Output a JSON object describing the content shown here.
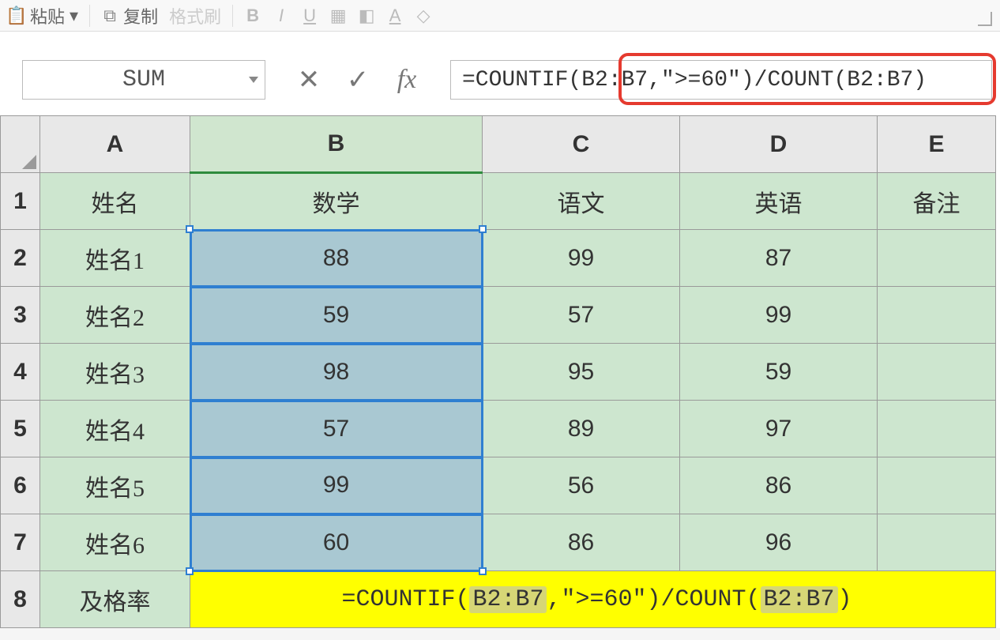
{
  "toolbar": {
    "paste": "粘贴",
    "copy": "复制",
    "format_painter": "格式刷"
  },
  "formula_bar": {
    "name_box": "SUM",
    "cancel_icon": "✕",
    "enter_icon": "✓",
    "fx_icon": "fx",
    "formula": "=COUNTIF(B2:B7,\">=60\")/COUNT(B2:B7)"
  },
  "columns": [
    "A",
    "B",
    "C",
    "D",
    "E"
  ],
  "headers": {
    "A": "姓名",
    "B": "数学",
    "C": "语文",
    "D": "英语",
    "E": "备注"
  },
  "rows": [
    {
      "n": "1"
    },
    {
      "n": "2",
      "A": "姓名1",
      "B": "88",
      "C": "99",
      "D": "87",
      "E": ""
    },
    {
      "n": "3",
      "A": "姓名2",
      "B": "59",
      "C": "57",
      "D": "99",
      "E": ""
    },
    {
      "n": "4",
      "A": "姓名3",
      "B": "98",
      "C": "95",
      "D": "59",
      "E": ""
    },
    {
      "n": "5",
      "A": "姓名4",
      "B": "57",
      "C": "89",
      "D": "97",
      "E": ""
    },
    {
      "n": "6",
      "A": "姓名5",
      "B": "99",
      "C": "56",
      "D": "86",
      "E": ""
    },
    {
      "n": "7",
      "A": "姓名6",
      "B": "60",
      "C": "86",
      "D": "96",
      "E": ""
    },
    {
      "n": "8",
      "A": "及格率"
    }
  ],
  "cell_formula": {
    "prefix": "=COUNTIF(",
    "ref1": "B2:B7",
    "mid": ",\">=60\")/COUNT(",
    "ref2": "B2:B7",
    "suffix": ")"
  }
}
